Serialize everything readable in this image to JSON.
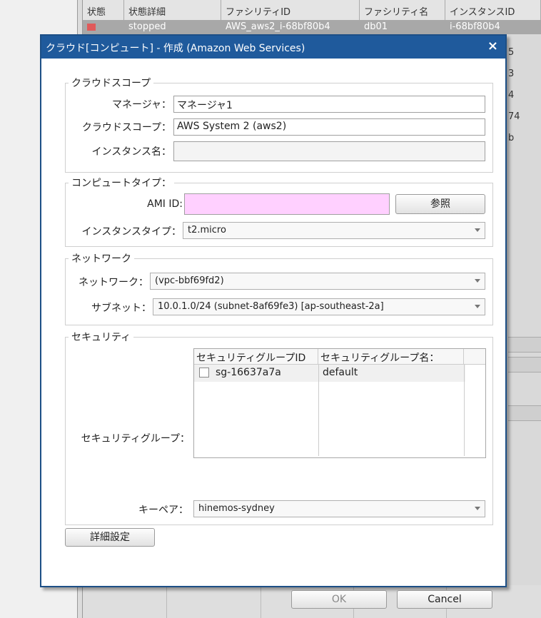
{
  "background": {
    "columns": [
      "状態",
      "状態詳細",
      "ファシリティID",
      "ファシリティ名",
      "インスタンスID"
    ],
    "selected_row": [
      "",
      "stopped",
      "AWS_aws2_i-68bf80b4",
      "db01",
      "i-68bf80b4"
    ],
    "row_stubs": [
      "5",
      "3",
      "4",
      "74",
      "b"
    ]
  },
  "dialog": {
    "title": "クラウド[コンピュート] - 作成 (Amazon Web Services)",
    "close": "×",
    "cloud_scope": {
      "legend": "クラウドスコープ",
      "manager_label": "マネージャ：",
      "manager_value": "マネージャ1",
      "scope_label": "クラウドスコープ：",
      "scope_value": "AWS System 2 (aws2)",
      "instance_name_label": "インスタンス名：",
      "instance_name_value": ""
    },
    "compute_type": {
      "legend": "コンピュートタイプ：",
      "ami_label": "AMI ID:",
      "ami_value": "",
      "browse_button": "参照",
      "instance_type_label": "インスタンスタイプ：",
      "instance_type_value": "t2.micro"
    },
    "network": {
      "legend": "ネットワーク",
      "network_label": "ネットワーク：",
      "network_value": "(vpc-bbf69fd2)",
      "subnet_label": "サブネット：",
      "subnet_value": "10.0.1.0/24 (subnet-8af69fe3) [ap-southeast-2a]"
    },
    "security": {
      "legend": "セキュリティ",
      "group_label": "セキュリティグループ：",
      "columns": [
        "セキュリティグループID",
        "セキュリティグループ名："
      ],
      "rows": [
        {
          "id": "sg-16637a7a",
          "name": "default",
          "checked": false
        }
      ],
      "keypair_label": "キーペア：",
      "keypair_value": "hinemos-sydney"
    },
    "detail_button": "詳細設定",
    "ok_button": "OK",
    "cancel_button": "Cancel"
  }
}
